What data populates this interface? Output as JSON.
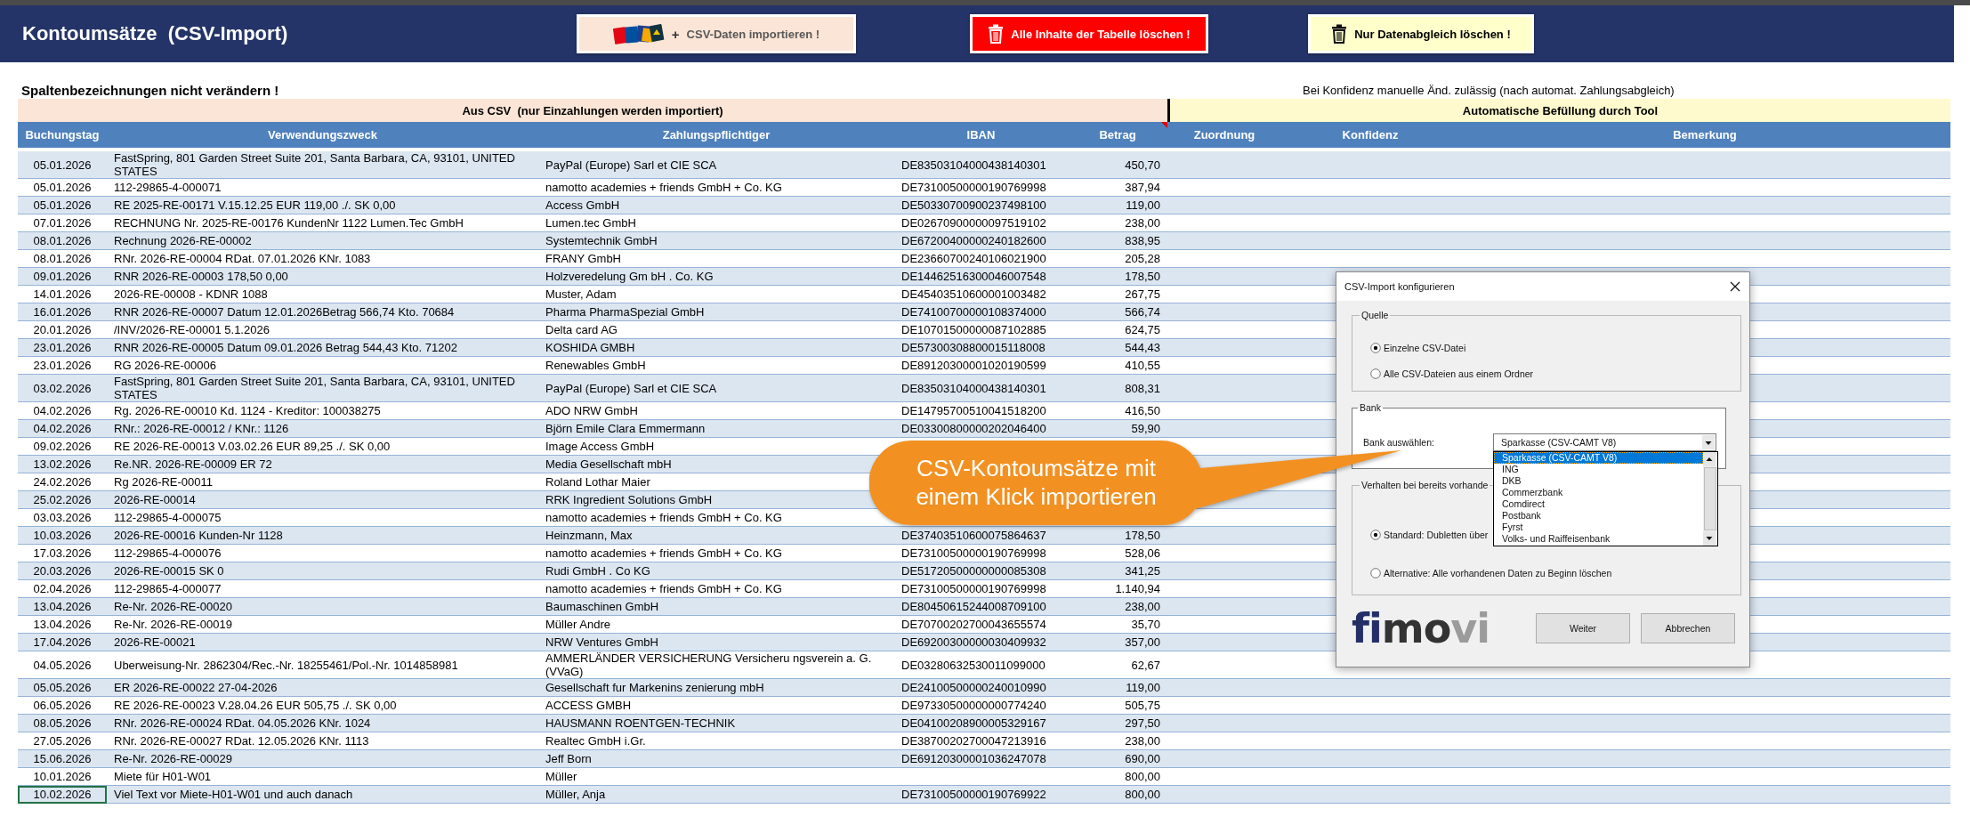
{
  "header": {
    "title": "Kontoumsätze  (CSV-Import)",
    "buttons": [
      {
        "kind": "import",
        "plus": "+",
        "label": "CSV-Daten importieren !"
      },
      {
        "kind": "danger",
        "label": "Alle Inhalte der Tabelle löschen !"
      },
      {
        "kind": "warning",
        "label": "Nur Datenabgleich löschen !"
      }
    ]
  },
  "notes": {
    "left": "Spaltenbezeichnungen nicht verändern !",
    "right": "Bei Konfidenz manuelle Änd. zulässig (nach automat. Zahlungsabgleich)"
  },
  "bands": [
    {
      "kind": "csv",
      "label": "Aus CSV  (nur Einzahlungen werden importiert)"
    },
    {
      "kind": "tool",
      "label": "Automatische Befüllung durch Tool"
    }
  ],
  "table": {
    "columns": [
      {
        "label": "Buchungstag",
        "comment": false
      },
      {
        "label": "Verwendungszweck",
        "comment": false
      },
      {
        "label": "Zahlungspflichtiger",
        "comment": false
      },
      {
        "label": "IBAN",
        "comment": false
      },
      {
        "label": "Betrag",
        "comment": true
      },
      {
        "label": "Zuordnung",
        "comment": false
      },
      {
        "label": "Konfidenz",
        "comment": false
      },
      {
        "label": "Bemerkung",
        "comment": false
      }
    ],
    "rows": [
      {
        "date": "05.01.2026",
        "purpose": "FastSpring, 801 Garden Street Suite 201, Santa Barbara, CA, 93101, UNITED STATES",
        "payer": "PayPal (Europe) Sarl et CIE SCA",
        "iban": "DE83503104000438140301",
        "amount": "450,70",
        "selected": false
      },
      {
        "date": "05.01.2026",
        "purpose": "112-29865-4-000071",
        "payer": "namotto academies + friends GmbH + Co. KG",
        "iban": "DE73100500000190769998",
        "amount": "387,94",
        "selected": false
      },
      {
        "date": "05.01.2026",
        "purpose": "RE 2025-RE-00171 V.15.12.25 EUR 119,00 ./. SK 0,00",
        "payer": "Access GmbH",
        "iban": "DE50330700900237498100",
        "amount": "119,00",
        "selected": false
      },
      {
        "date": "07.01.2026",
        "purpose": "RECHNUNG Nr. 2025-RE-00176 KundenNr 1122 Lumen.Tec GmbH",
        "payer": "Lumen.tec GmbH",
        "iban": "DE02670900000097519102",
        "amount": "238,00",
        "selected": false
      },
      {
        "date": "08.01.2026",
        "purpose": "Rechnung 2026-RE-00002",
        "payer": "Systemtechnik GmbH",
        "iban": "DE67200400000240182600",
        "amount": "838,95",
        "selected": false
      },
      {
        "date": "08.01.2026",
        "purpose": "RNr. 2026-RE-00004 RDat. 07.01.2026 KNr. 1083",
        "payer": "FRANY GmbH",
        "iban": "DE23660700240106021900",
        "amount": "205,28",
        "selected": false
      },
      {
        "date": "09.01.2026",
        "purpose": "RNR 2026-RE-00003 178,50 0,00",
        "payer": "Holzveredelung Gm bH . Co. KG",
        "iban": "DE14462516300046007548",
        "amount": "178,50",
        "selected": false
      },
      {
        "date": "14.01.2026",
        "purpose": "2026-RE-00008 - KDNR 1088",
        "payer": "Muster, Adam",
        "iban": "DE45403510600001003482",
        "amount": "267,75",
        "selected": false
      },
      {
        "date": "16.01.2026",
        "purpose": "RNR 2026-RE-00007 Datum 12.01.2026Betrag 566,74 Kto. 70684",
        "payer": "Pharma PharmaSpezial GmbH",
        "iban": "DE74100700000108374000",
        "amount": "566,74",
        "selected": false
      },
      {
        "date": "20.01.2026",
        "purpose": "/INV/2026-RE-00001 5.1.2026",
        "payer": "Delta card AG",
        "iban": "DE10701500000087102885",
        "amount": "624,75",
        "selected": false
      },
      {
        "date": "23.01.2026",
        "purpose": "RNR 2026-RE-00005 Datum 09.01.2026 Betrag 544,43 Kto. 71202",
        "payer": "KOSHIDA GMBH",
        "iban": "DE57300308800015118008",
        "amount": "544,43",
        "selected": false
      },
      {
        "date": "23.01.2026",
        "purpose": "RG 2026-RE-00006",
        "payer": "Renewables GmbH",
        "iban": "DE89120300001020190599",
        "amount": "410,55",
        "selected": false
      },
      {
        "date": "03.02.2026",
        "purpose": "FastSpring, 801 Garden Street Suite 201, Santa Barbara, CA, 93101, UNITED STATES",
        "payer": "PayPal (Europe) Sarl et CIE SCA",
        "iban": "DE83503104000438140301",
        "amount": "808,31",
        "selected": false
      },
      {
        "date": "04.02.2026",
        "purpose": "Rg. 2026-RE-00010 Kd. 1124 - Kreditor: 100038275",
        "payer": "ADO NRW GmbH",
        "iban": "DE14795700510041518200",
        "amount": "416,50",
        "selected": false
      },
      {
        "date": "04.02.2026",
        "purpose": "RNr.: 2026-RE-00012 / KNr.: 1126",
        "payer": "Björn Emile Clara Emmermann",
        "iban": "DE03300800000202046400",
        "amount": "59,90",
        "selected": false
      },
      {
        "date": "09.02.2026",
        "purpose": "RE 2026-RE-00013 V.03.02.26 EUR 89,25 ./. SK 0,00",
        "payer": "Image Access GmbH",
        "selected": false
      },
      {
        "date": "13.02.2026",
        "purpose": "Re.NR. 2026-RE-00009 ER 72",
        "payer": "Media Gesellschaft mbH",
        "selected": false
      },
      {
        "date": "24.02.2026",
        "purpose": "Rg 2026-RE-00011",
        "payer": "Roland Lothar Maier",
        "selected": false
      },
      {
        "date": "25.02.2026",
        "purpose": "2026-RE-00014",
        "payer": "RRK Ingredient Solutions GmbH",
        "selected": false
      },
      {
        "date": "03.03.2026",
        "purpose": "112-29865-4-000075",
        "payer": "namotto academies + friends GmbH + Co. KG",
        "selected": false
      },
      {
        "date": "10.03.2026",
        "purpose": "2026-RE-00016 Kunden-Nr 1128",
        "payer": "Heinzmann, Max",
        "iban": "DE37403510600075864637",
        "amount": "178,50",
        "selected": false
      },
      {
        "date": "17.03.2026",
        "purpose": "112-29865-4-000076",
        "payer": "namotto academies + friends GmbH + Co. KG",
        "iban": "DE73100500000190769998",
        "amount": "528,06",
        "selected": false
      },
      {
        "date": "20.03.2026",
        "purpose": "2026-RE-00015 SK 0",
        "payer": "Rudi GmbH . Co KG",
        "iban": "DE51720500000000085308",
        "amount": "341,25",
        "selected": false
      },
      {
        "date": "02.04.2026",
        "purpose": "112-29865-4-000077",
        "payer": "namotto academies + friends GmbH + Co. KG",
        "iban": "DE73100500000190769998",
        "amount": "1.140,94",
        "selected": false
      },
      {
        "date": "13.04.2026",
        "purpose": "Re-Nr. 2026-RE-00020",
        "payer": "Baumaschinen GmbH",
        "iban": "DE80450615244008709100",
        "amount": "238,00",
        "selected": false
      },
      {
        "date": "13.04.2026",
        "purpose": "Re-Nr. 2026-RE-00019",
        "payer": "Müller Andre",
        "iban": "DE70700202700043655574",
        "amount": "35,70",
        "selected": false
      },
      {
        "date": "17.04.2026",
        "purpose": "2026-RE-00021",
        "payer": "NRW Ventures GmbH",
        "iban": "DE69200300000030409932",
        "amount": "357,00",
        "selected": false
      },
      {
        "date": "04.05.2026",
        "purpose": "Uberweisung-Nr. 2862304/Rec.-Nr. 18255461/Pol.-Nr. 1014858981",
        "payer": "AMMERLÄNDER VERSICHERUNG Versicheru ngsverein a. G. (VVaG)",
        "iban": "DE03280632530011099000",
        "amount": "62,67",
        "selected": false
      },
      {
        "date": "05.05.2026",
        "purpose": "ER 2026-RE-00022 27-04-2026",
        "payer": "Gesellschaft fur Markenins zenierung mbH",
        "iban": "DE24100500000240010990",
        "amount": "119,00",
        "selected": false
      },
      {
        "date": "06.05.2026",
        "purpose": "RE 2026-RE-00023 V.28.04.26 EUR 505,75 ./. SK 0,00",
        "payer": "ACCESS GMBH",
        "iban": "DE97330500000000774240",
        "amount": "505,75",
        "selected": false
      },
      {
        "date": "08.05.2026",
        "purpose": "RNr. 2026-RE-00024 RDat. 04.05.2026 KNr. 1024",
        "payer": "HAUSMANN ROENTGEN-TECHNIK",
        "iban": "DE04100208900005329167",
        "amount": "297,50",
        "selected": false
      },
      {
        "date": "27.05.2026",
        "purpose": "RNr. 2026-RE-00027 RDat. 12.05.2026 KNr. 1113",
        "payer": "Realtec GmbH i.Gr.",
        "iban": "DE38700202700047213916",
        "amount": "238,00",
        "selected": false
      },
      {
        "date": "15.06.2026",
        "purpose": "Re-Nr. 2026-RE-00029",
        "payer": "Jeff Born",
        "iban": "DE69120300001036247078",
        "amount": "690,00",
        "selected": false
      },
      {
        "date": "10.01.2026",
        "purpose": "Miete für H01-W01",
        "payer": "Müller",
        "amount": "800,00",
        "selected": false
      },
      {
        "date": "10.02.2026",
        "purpose": "Viel Text vor Miete-H01-W01 und auch danach",
        "payer": "Müller, Anja",
        "iban": "DE73100500000190769922",
        "amount": "800,00",
        "selected": true
      }
    ]
  },
  "dialog": {
    "title": "CSV-Import konfigurieren",
    "groups": [
      {
        "kind": "radios",
        "label": "Quelle",
        "options": [
          {
            "label": "Einzelne CSV-Datei",
            "selected": true
          },
          {
            "label": "Alle CSV-Dateien aus einem Ordner",
            "selected": false
          }
        ]
      },
      {
        "kind": "combo",
        "label": "Bank",
        "field_label": "Bank auswählen:",
        "value": "Sparkasse (CSV-CAMT V8)",
        "expanded": true,
        "options": [
          {
            "label": "Sparkasse (CSV-CAMT V8)",
            "selected": true
          },
          {
            "label": "ING",
            "selected": false
          },
          {
            "label": "DKB",
            "selected": false
          },
          {
            "label": "Commerzbank",
            "selected": false
          },
          {
            "label": "Comdirect",
            "selected": false
          },
          {
            "label": "Postbank",
            "selected": false
          },
          {
            "label": "Fyrst",
            "selected": false
          },
          {
            "label": "Volks- und Raiffeisenbank",
            "selected": false
          }
        ]
      },
      {
        "kind": "radios",
        "label": "Verhalten bei bereits vorhande",
        "options": [
          {
            "label": "Standard: Dubletten über",
            "selected": true
          },
          {
            "label": "Alternative: Alle vorhandenen Daten zu Beginn löschen",
            "selected": false
          }
        ]
      }
    ],
    "logo": [
      {
        "text": "fi",
        "color": "#232f66"
      },
      {
        "text": "mo",
        "color": "#333333"
      },
      {
        "text": "vi",
        "color": "#9b9b9b"
      }
    ],
    "buttons": [
      "Weiter",
      "Abbrechen"
    ]
  },
  "callout": {
    "text": "CSV-Kontoumsätze mit einem Klick importieren"
  }
}
